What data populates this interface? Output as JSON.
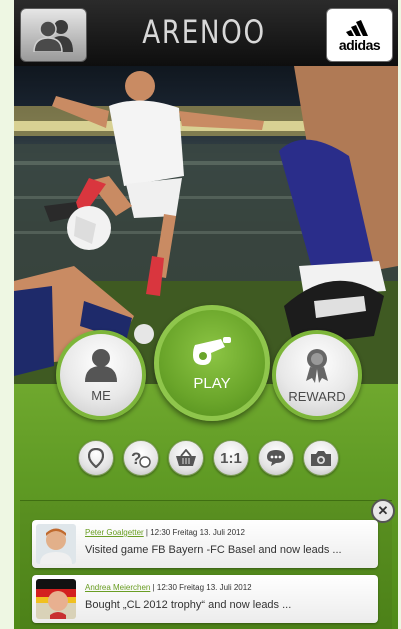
{
  "header": {
    "title": "ARENOO",
    "sponsor_label": "adidas"
  },
  "actions": {
    "me_label": "ME",
    "play_label": "PLAY",
    "reward_label": "REWARD"
  },
  "quick_icons": [
    "location-pin-icon",
    "help-ball-icon",
    "basket-icon",
    "one-on-one-icon",
    "chat-icon",
    "camera-icon"
  ],
  "quick_icon_texts": {
    "one_on_one": "1:1"
  },
  "feed": {
    "items": [
      {
        "name": "Peter Goalgetter",
        "meta": " | 12:30 Freitag 13. Juli 2012",
        "message": "Visited game FB Bayern -FC Basel and now leads ..."
      },
      {
        "name": "Andrea Meierchen",
        "meta": " | 12:30 Freitag 13. Juli 2012",
        "message": "Bought „CL 2012 trophy“ and now leads ..."
      }
    ]
  },
  "colors": {
    "panel_green": "#5f9a24",
    "play_green": "#6aa52a",
    "name_link": "#6a9e24"
  }
}
